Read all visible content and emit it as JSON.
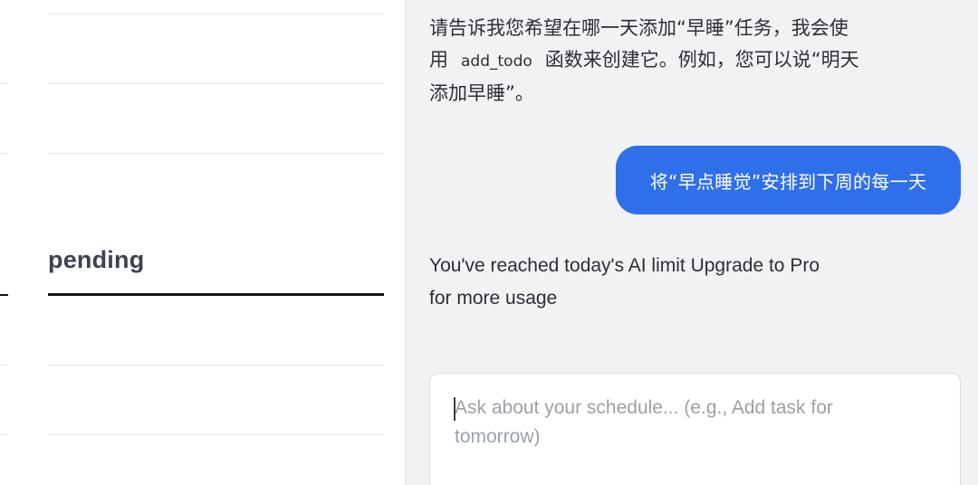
{
  "todo_list": {
    "section_label": "pending"
  },
  "chat": {
    "assistant_message": {
      "line1": "请告诉我您希望在哪一天添加“早睡”任务，我会使",
      "line2_prefix": "用",
      "code": "add_todo",
      "line2_suffix": "函数来创建它。例如，您可以说“明天",
      "line3": "添加早睡”。"
    },
    "user_message": "将“早点睡觉”安排到下周的每一天",
    "limit_message": {
      "line1": "You've reached today's AI limit Upgrade to Pro",
      "line2": "for more usage"
    },
    "input": {
      "value": "",
      "placeholder_line1": "Ask about your schedule... (e.g., Add task for",
      "placeholder_line2": "tomorrow)"
    }
  },
  "colors": {
    "user_bubble": "#2f6fe9",
    "chat_background": "#f1f2f4",
    "pending_underline": "#111418"
  }
}
